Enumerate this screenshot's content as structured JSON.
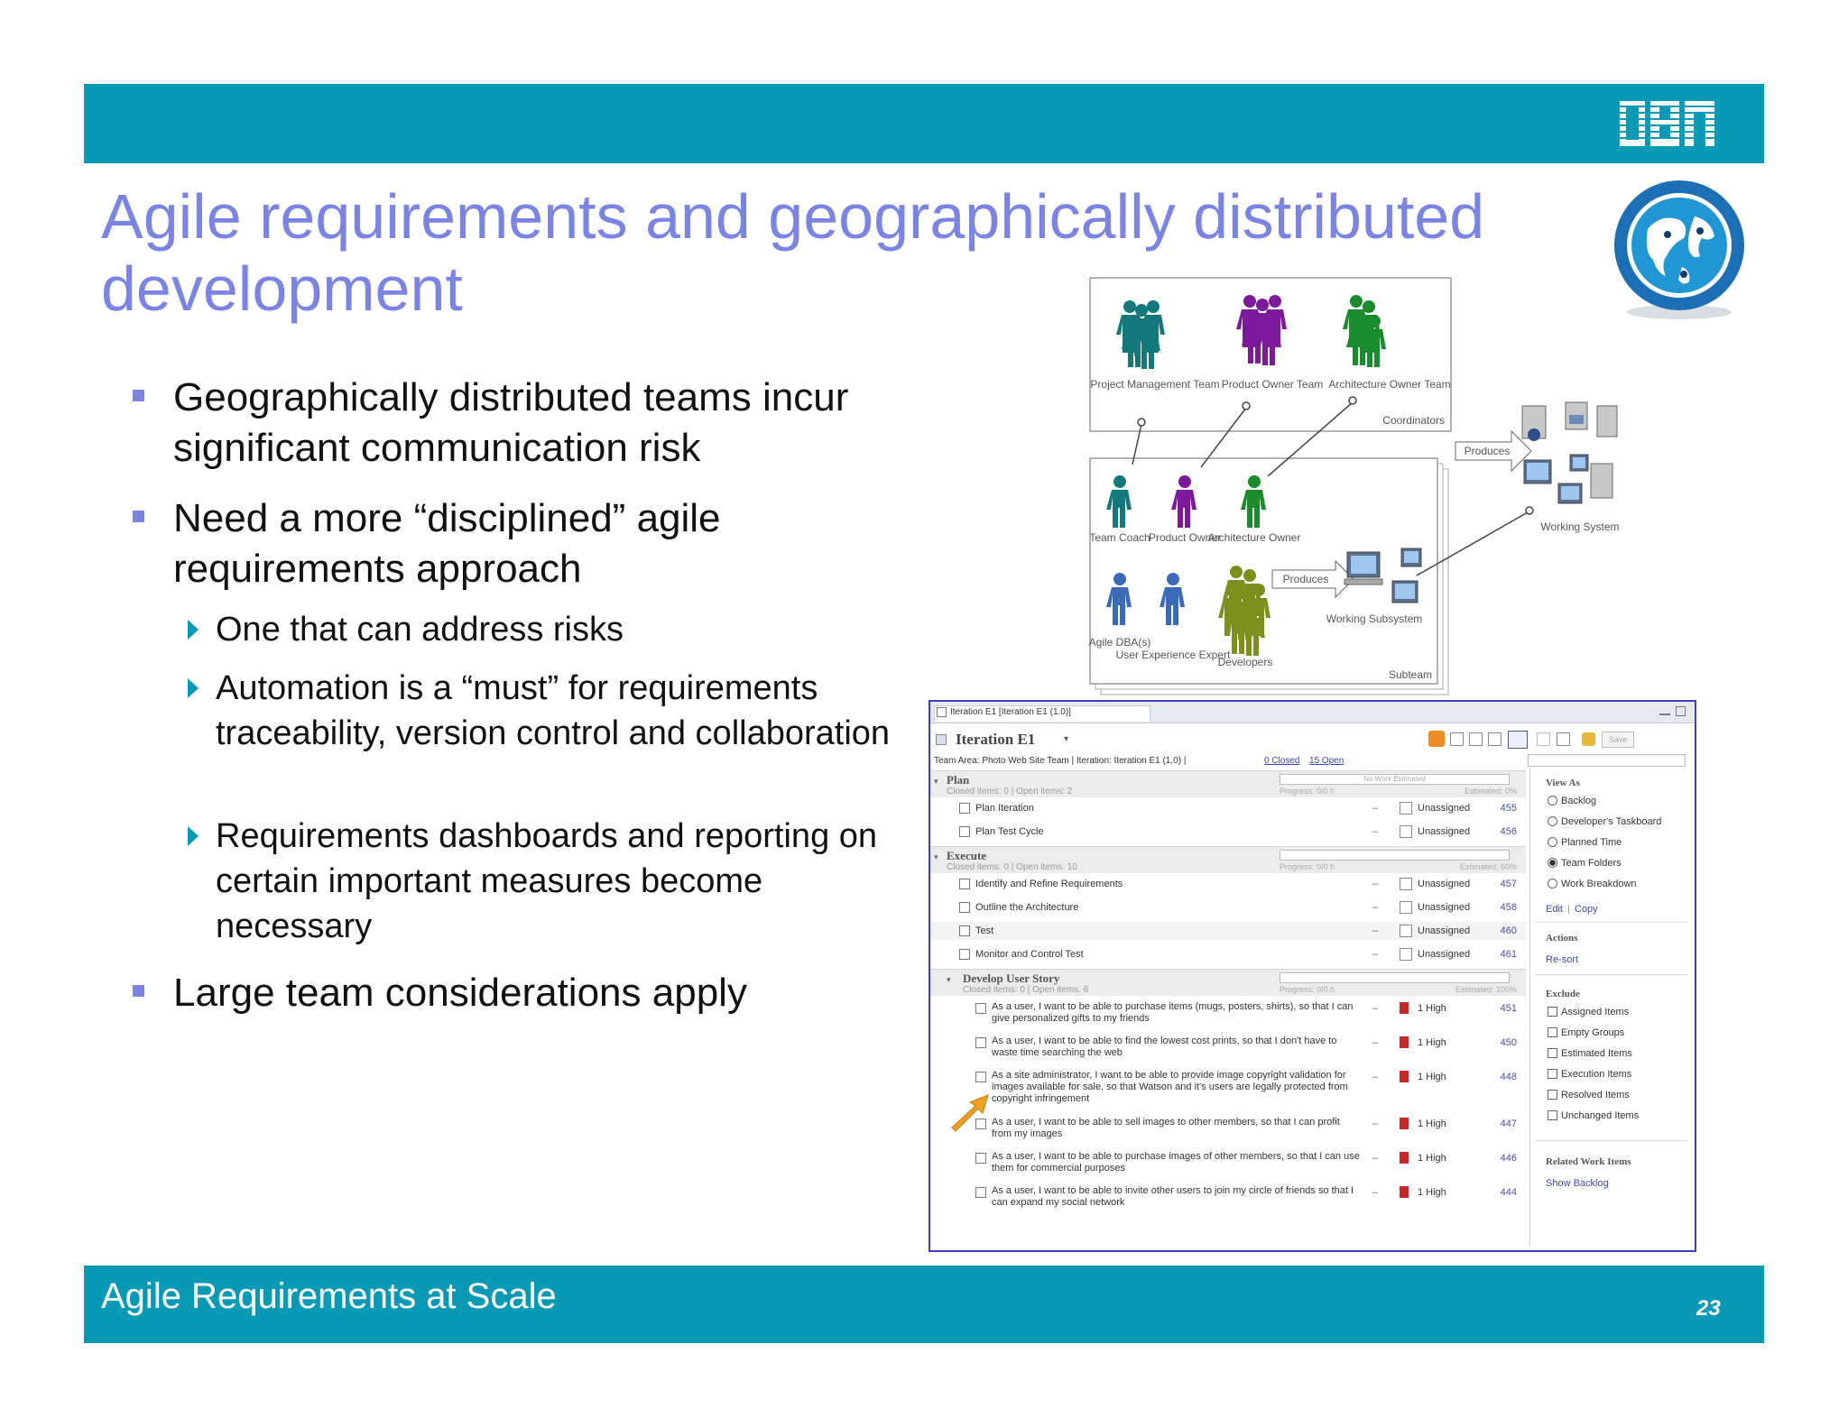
{
  "slide": {
    "title": "Agile requirements and geographically distributed development",
    "logo_text": "IBM",
    "footer": "Agile Requirements at Scale",
    "page_number": "23",
    "colors": {
      "band": "#0899b5",
      "title": "#7b84e3",
      "bullet": "#7b84e3"
    },
    "globe_icon": "globe-icon"
  },
  "bullets": [
    {
      "text": "Geographically distributed teams incur significant communication risk"
    },
    {
      "text": "Need a more “disciplined” agile requirements approach"
    },
    {
      "text": "One that can address risks"
    },
    {
      "text": "Automation is a “must” for requirements traceability, version control and collaboration"
    },
    {
      "text": "Requirements dashboards and reporting on certain important measures become necessary"
    },
    {
      "text": "Large team considerations apply"
    }
  ],
  "diagram": {
    "labels": {
      "pm_team": "Project Management Team",
      "product_owner_team": "Product Owner Team",
      "architecture_owner_team": "Architecture Owner Team",
      "coordinators": "Coordinators",
      "produces_top": "Produces",
      "working_system": "Working System",
      "team_coach": "Team Coach",
      "product_owner": "Product Owner",
      "architecture_owner": "Architecture Owner",
      "produces_mid": "Produces",
      "working_subsystem": "Working Subsystem",
      "agile_dbas": "Agile DBA(s)",
      "ux_expert": "User Experience Expert",
      "developers": "Developers",
      "subteam": "Subteam"
    }
  },
  "rtc": {
    "tab_title": "Iteration E1 [Iteration E1 (1.0)]",
    "header_title": "Iteration E1",
    "team_area": "Team Area: Photo Web Site Team | Iteration: Iteration E1 (1.0) |",
    "closed_link": "0 Closed",
    "open_link": "15 Open",
    "save_label": "Save",
    "sections": [
      {
        "name": "Plan",
        "sub": "Closed items: 0 | Open items: 2",
        "bar_text": "No Work Estimated",
        "progress": "Progress: 0/0 h",
        "estimated": "Estimated: 0%"
      },
      {
        "name": "Execute",
        "sub": "Closed items: 0 | Open items: 10",
        "bar_text": "",
        "progress": "Progress: 0/0 h",
        "estimated": "Estimated: 60%"
      },
      {
        "name": "Develop User Story",
        "sub": "Closed items: 0 | Open items: 6",
        "bar_text": "",
        "progress": "Progress: 0/0 h",
        "estimated": "Estimated: 100%"
      }
    ],
    "plan_items": [
      {
        "summary": "Plan Iteration",
        "dash": "–",
        "status": "Unassigned",
        "id": "455"
      },
      {
        "summary": "Plan Test Cycle",
        "dash": "–",
        "status": "Unassigned",
        "id": "456"
      }
    ],
    "execute_items": [
      {
        "summary": "Identify and Refine Requirements",
        "dash": "–",
        "status": "Unassigned",
        "id": "457"
      },
      {
        "summary": "Outline the Architecture",
        "dash": "–",
        "status": "Unassigned",
        "id": "458"
      },
      {
        "summary": "Test",
        "dash": "–",
        "status": "Unassigned",
        "id": "460"
      },
      {
        "summary": "Monitor and Control Test",
        "dash": "–",
        "status": "Unassigned",
        "id": "461"
      }
    ],
    "story_items": [
      {
        "summary": "As a user, I want to be able to purchase items (mugs, posters, shirts), so that I can give personalized gifts to my friends",
        "dash": "–",
        "status": "1 High",
        "id": "451"
      },
      {
        "summary": "As a user, I want to be able to find the lowest cost prints, so that I don't have to waste time searching the web",
        "dash": "–",
        "status": "1 High",
        "id": "450"
      },
      {
        "summary": "As a site administrator, I want to be able to provide image copyright validation for images available for sale, so that Watson and it's users are legally protected from copyright infringement",
        "dash": "–",
        "status": "1 High",
        "id": "448"
      },
      {
        "summary": "As a user, I want to be able to sell images to other members, so that I can profit from my images",
        "dash": "–",
        "status": "1 High",
        "id": "447"
      },
      {
        "summary": "As a user, I want to be able to purchase images of other members, so that I can use them for commercial purposes",
        "dash": "–",
        "status": "1 High",
        "id": "446"
      },
      {
        "summary": "As a user, I want to be able to invite other users to join my circle of friends so that I can expand my social network",
        "dash": "–",
        "status": "1 High",
        "id": "444"
      }
    ],
    "view_as": {
      "heading": "View As",
      "options": [
        "Backlog",
        "Developer's Taskboard",
        "Planned Time",
        "Team Folders",
        "Work Breakdown"
      ],
      "selected": "Team Folders",
      "edit": "Edit",
      "copy": "Copy"
    },
    "actions": {
      "heading": "Actions",
      "resort": "Re-sort"
    },
    "exclude": {
      "heading": "Exclude",
      "options": [
        "Assigned Items",
        "Empty Groups",
        "Estimated Items",
        "Execution Items",
        "Resolved Items",
        "Unchanged Items"
      ]
    },
    "related": {
      "heading": "Related Work Items",
      "link": "Show Backlog"
    }
  }
}
